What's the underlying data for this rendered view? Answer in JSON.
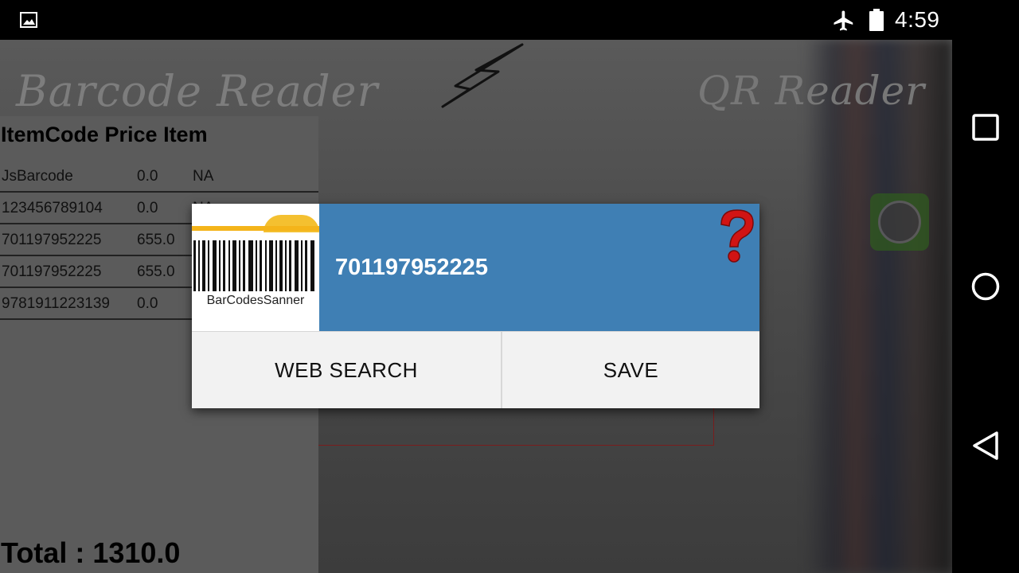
{
  "status_bar": {
    "clock": "4:59",
    "icons": [
      "image-icon",
      "airplane-mode-icon",
      "battery-icon"
    ]
  },
  "app": {
    "title_left": "Barcode Reader",
    "title_right": "QR Reader",
    "logo_icon": "lightning-bolt-icon"
  },
  "list": {
    "header": "ItemCode Price Item",
    "rows": [
      {
        "code": "JsBarcode",
        "price": "0.0",
        "item": "NA"
      },
      {
        "code": "123456789104",
        "price": "0.0",
        "item": "NA"
      },
      {
        "code": "701197952225",
        "price": "655.0",
        "item": ""
      },
      {
        "code": "701197952225",
        "price": "655.0",
        "item": ""
      },
      {
        "code": "9781911223139",
        "price": "0.0",
        "item": ""
      }
    ],
    "total": "Total : 1310.0"
  },
  "dialog": {
    "logo_caption": "BarCodesSanner",
    "code": "701197952225",
    "help_icon": "question-mark-icon",
    "buttons": {
      "web_search": "WEB  SEARCH",
      "save": "SAVE"
    },
    "header_color": "#3f7fb4"
  },
  "nav_bar": {
    "buttons": [
      "recents-icon",
      "home-icon",
      "back-icon"
    ]
  }
}
